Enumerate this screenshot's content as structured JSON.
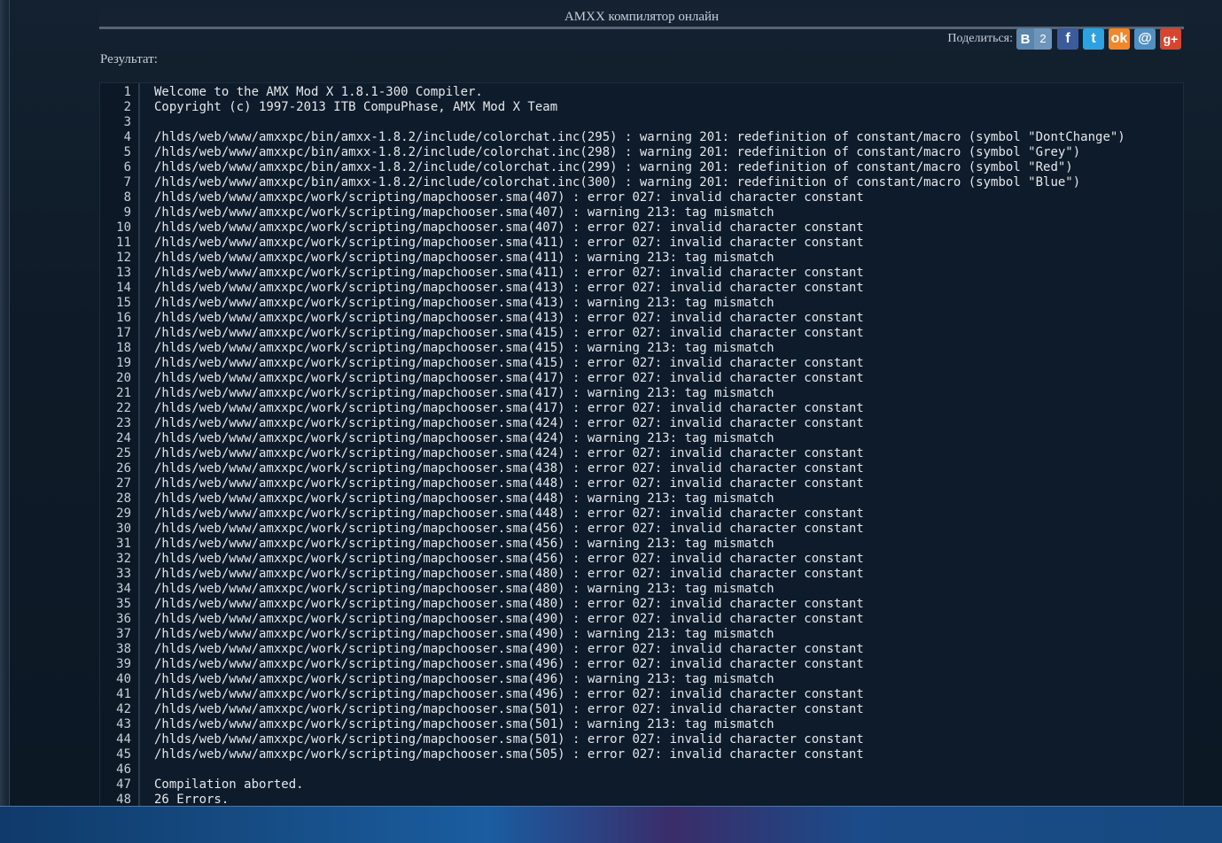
{
  "header": {
    "title": "AMXX компилятор онлайн"
  },
  "share": {
    "label": "Поделиться:",
    "vk": {
      "letter": "B",
      "count": "2",
      "icon": "vk-icon"
    },
    "facebook": {
      "glyph": "f",
      "icon": "facebook-icon",
      "color": "#3b5b9a"
    },
    "twitter": {
      "glyph": "t",
      "icon": "twitter-icon",
      "color": "#2ca3e0"
    },
    "odnoklassniki": {
      "glyph": "ok",
      "icon": "odnoklassniki-icon",
      "color": "#f0882b"
    },
    "mail": {
      "glyph": "@",
      "icon": "mail-icon",
      "color": "#4f8fc2"
    },
    "googleplus": {
      "glyph": "g+",
      "icon": "google-plus-icon",
      "color": "#d8452f"
    }
  },
  "result": {
    "label": "Результат:"
  },
  "output": {
    "lines": [
      "Welcome to the AMX Mod X 1.8.1-300 Compiler.",
      "Copyright (c) 1997-2013 ITB CompuPhase, AMX Mod X Team",
      "",
      "/hlds/web/www/amxxpc/bin/amxx-1.8.2/include/colorchat.inc(295) : warning 201: redefinition of constant/macro (symbol \"DontChange\")",
      "/hlds/web/www/amxxpc/bin/amxx-1.8.2/include/colorchat.inc(298) : warning 201: redefinition of constant/macro (symbol \"Grey\")",
      "/hlds/web/www/amxxpc/bin/amxx-1.8.2/include/colorchat.inc(299) : warning 201: redefinition of constant/macro (symbol \"Red\")",
      "/hlds/web/www/amxxpc/bin/amxx-1.8.2/include/colorchat.inc(300) : warning 201: redefinition of constant/macro (symbol \"Blue\")",
      "/hlds/web/www/amxxpc/work/scripting/mapchooser.sma(407) : error 027: invalid character constant",
      "/hlds/web/www/amxxpc/work/scripting/mapchooser.sma(407) : warning 213: tag mismatch",
      "/hlds/web/www/amxxpc/work/scripting/mapchooser.sma(407) : error 027: invalid character constant",
      "/hlds/web/www/amxxpc/work/scripting/mapchooser.sma(411) : error 027: invalid character constant",
      "/hlds/web/www/amxxpc/work/scripting/mapchooser.sma(411) : warning 213: tag mismatch",
      "/hlds/web/www/amxxpc/work/scripting/mapchooser.sma(411) : error 027: invalid character constant",
      "/hlds/web/www/amxxpc/work/scripting/mapchooser.sma(413) : error 027: invalid character constant",
      "/hlds/web/www/amxxpc/work/scripting/mapchooser.sma(413) : warning 213: tag mismatch",
      "/hlds/web/www/amxxpc/work/scripting/mapchooser.sma(413) : error 027: invalid character constant",
      "/hlds/web/www/amxxpc/work/scripting/mapchooser.sma(415) : error 027: invalid character constant",
      "/hlds/web/www/amxxpc/work/scripting/mapchooser.sma(415) : warning 213: tag mismatch",
      "/hlds/web/www/amxxpc/work/scripting/mapchooser.sma(415) : error 027: invalid character constant",
      "/hlds/web/www/amxxpc/work/scripting/mapchooser.sma(417) : error 027: invalid character constant",
      "/hlds/web/www/amxxpc/work/scripting/mapchooser.sma(417) : warning 213: tag mismatch",
      "/hlds/web/www/amxxpc/work/scripting/mapchooser.sma(417) : error 027: invalid character constant",
      "/hlds/web/www/amxxpc/work/scripting/mapchooser.sma(424) : error 027: invalid character constant",
      "/hlds/web/www/amxxpc/work/scripting/mapchooser.sma(424) : warning 213: tag mismatch",
      "/hlds/web/www/amxxpc/work/scripting/mapchooser.sma(424) : error 027: invalid character constant",
      "/hlds/web/www/amxxpc/work/scripting/mapchooser.sma(438) : error 027: invalid character constant",
      "/hlds/web/www/amxxpc/work/scripting/mapchooser.sma(448) : error 027: invalid character constant",
      "/hlds/web/www/amxxpc/work/scripting/mapchooser.sma(448) : warning 213: tag mismatch",
      "/hlds/web/www/amxxpc/work/scripting/mapchooser.sma(448) : error 027: invalid character constant",
      "/hlds/web/www/amxxpc/work/scripting/mapchooser.sma(456) : error 027: invalid character constant",
      "/hlds/web/www/amxxpc/work/scripting/mapchooser.sma(456) : warning 213: tag mismatch",
      "/hlds/web/www/amxxpc/work/scripting/mapchooser.sma(456) : error 027: invalid character constant",
      "/hlds/web/www/amxxpc/work/scripting/mapchooser.sma(480) : error 027: invalid character constant",
      "/hlds/web/www/amxxpc/work/scripting/mapchooser.sma(480) : warning 213: tag mismatch",
      "/hlds/web/www/amxxpc/work/scripting/mapchooser.sma(480) : error 027: invalid character constant",
      "/hlds/web/www/amxxpc/work/scripting/mapchooser.sma(490) : error 027: invalid character constant",
      "/hlds/web/www/amxxpc/work/scripting/mapchooser.sma(490) : warning 213: tag mismatch",
      "/hlds/web/www/amxxpc/work/scripting/mapchooser.sma(490) : error 027: invalid character constant",
      "/hlds/web/www/amxxpc/work/scripting/mapchooser.sma(496) : error 027: invalid character constant",
      "/hlds/web/www/amxxpc/work/scripting/mapchooser.sma(496) : warning 213: tag mismatch",
      "/hlds/web/www/amxxpc/work/scripting/mapchooser.sma(496) : error 027: invalid character constant",
      "/hlds/web/www/amxxpc/work/scripting/mapchooser.sma(501) : error 027: invalid character constant",
      "/hlds/web/www/amxxpc/work/scripting/mapchooser.sma(501) : warning 213: tag mismatch",
      "/hlds/web/www/amxxpc/work/scripting/mapchooser.sma(501) : error 027: invalid character constant",
      "/hlds/web/www/amxxpc/work/scripting/mapchooser.sma(505) : error 027: invalid character constant",
      "",
      "Compilation aborted.",
      "26 Errors."
    ]
  }
}
